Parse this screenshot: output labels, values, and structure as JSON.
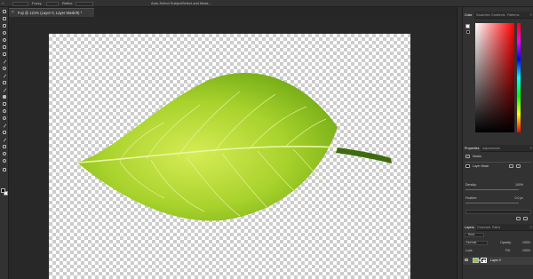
{
  "options_bar": {
    "preserve_label": "Fuzzy",
    "sample_label": "Refine",
    "auto_label": "Auto-Select Subject",
    "select_label": "Select and Mask..."
  },
  "document": {
    "tab_title": "Fuji @ 121% (Layer 0, Layer Mask/8) *",
    "close_glyph": "×"
  },
  "tools": {
    "icons": [
      "move-tool-icon",
      "artboard-tool-icon",
      "marquee-tool-icon",
      "lasso-tool-icon",
      "quick-select-tool-icon",
      "crop-tool-icon",
      "frame-tool-icon",
      "eyedropper-tool-icon",
      "spot-heal-tool-icon",
      "brush-tool-icon",
      "clone-stamp-tool-icon",
      "history-brush-tool-icon",
      "eraser-tool-icon",
      "gradient-tool-icon",
      "blur-tool-icon",
      "dodge-tool-icon",
      "pen-tool-icon",
      "type-tool-icon",
      "path-select-tool-icon",
      "shape-tool-icon",
      "hand-tool-icon",
      "zoom-tool-icon",
      "edit-toolbar-icon"
    ],
    "foreground_color": "#000000",
    "background_color": "#ffffff"
  },
  "color_panel": {
    "tabs": [
      "Color",
      "Swatches",
      "Gradients",
      "Patterns"
    ],
    "active_tab": "Color",
    "hue_color": "#ff0000"
  },
  "properties_panel": {
    "tabs": [
      "Properties",
      "Adjustments"
    ],
    "masks_label": "Masks",
    "layer_mask_label": "Layer Mask",
    "density_label": "Density:",
    "density_value": "100%",
    "feather_label": "Feather:",
    "feather_value": "0.0 px"
  },
  "layers_panel": {
    "tabs": [
      "Layers",
      "Channels",
      "Paths"
    ],
    "kind_label": "Kind",
    "blend_mode": "Normal",
    "opacity_label": "Opacity:",
    "opacity_value": "100%",
    "lock_label": "Lock:",
    "fill_label": "Fill:",
    "fill_value": "100%",
    "layer_name": "Layer 0"
  },
  "canvas": {
    "leaf_color_light": "#c9e63a",
    "leaf_color_dark": "#5e9a12",
    "vein_color": "#e6f39a",
    "stem_color": "#3f6b0d"
  }
}
